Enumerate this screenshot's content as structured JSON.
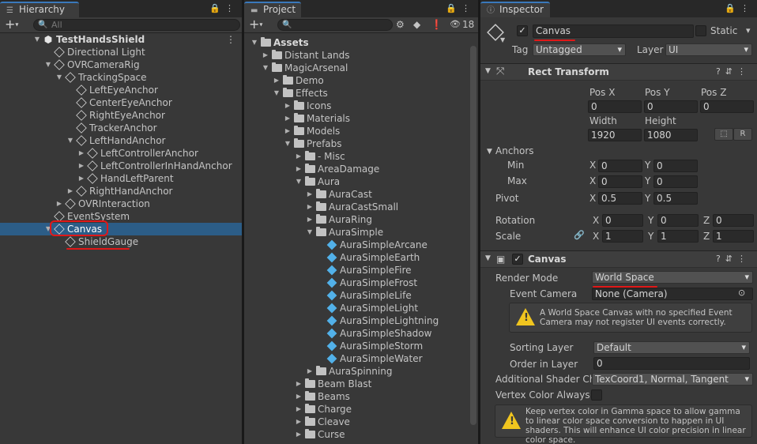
{
  "hierarchy": {
    "tab_label": "Hierarchy",
    "search_placeholder": "All",
    "rows": [
      {
        "label": "TestHandsShield",
        "depth": 0,
        "arrow": "down",
        "icon": "unity-scene-icon",
        "bold": true
      },
      {
        "label": "Directional Light",
        "depth": 1,
        "arrow": "",
        "icon": "cube-icon"
      },
      {
        "label": "OVRCameraRig",
        "depth": 1,
        "arrow": "down",
        "icon": "cube-icon"
      },
      {
        "label": "TrackingSpace",
        "depth": 2,
        "arrow": "down",
        "icon": "cube-icon"
      },
      {
        "label": "LeftEyeAnchor",
        "depth": 3,
        "arrow": "",
        "icon": "cube-icon"
      },
      {
        "label": "CenterEyeAnchor",
        "depth": 3,
        "arrow": "",
        "icon": "cube-icon"
      },
      {
        "label": "RightEyeAnchor",
        "depth": 3,
        "arrow": "",
        "icon": "cube-icon"
      },
      {
        "label": "TrackerAnchor",
        "depth": 3,
        "arrow": "",
        "icon": "cube-icon"
      },
      {
        "label": "LeftHandAnchor",
        "depth": 3,
        "arrow": "down",
        "icon": "cube-icon"
      },
      {
        "label": "LeftControllerAnchor",
        "depth": 4,
        "arrow": "right",
        "icon": "cube-icon"
      },
      {
        "label": "LeftControllerInHandAnchor",
        "depth": 4,
        "arrow": "right",
        "icon": "cube-icon"
      },
      {
        "label": "HandLeftParent",
        "depth": 4,
        "arrow": "right",
        "icon": "cube-icon"
      },
      {
        "label": "RightHandAnchor",
        "depth": 3,
        "arrow": "right",
        "icon": "cube-icon"
      },
      {
        "label": "OVRInteraction",
        "depth": 2,
        "arrow": "right",
        "icon": "cube-icon"
      },
      {
        "label": "EventSystem",
        "depth": 1,
        "arrow": "",
        "icon": "cube-icon"
      },
      {
        "label": "Canvas",
        "depth": 1,
        "arrow": "down",
        "icon": "cube-icon",
        "selected": true
      },
      {
        "label": "ShieldGauge",
        "depth": 2,
        "arrow": "",
        "icon": "cube-icon"
      }
    ]
  },
  "project": {
    "tab_label": "Project",
    "hidden_count": "18",
    "rows": [
      {
        "label": "Assets",
        "depth": 0,
        "arrow": "down",
        "icon": "folder",
        "bold": true
      },
      {
        "label": "Distant Lands",
        "depth": 1,
        "arrow": "right",
        "icon": "folder"
      },
      {
        "label": "MagicArsenal",
        "depth": 1,
        "arrow": "down",
        "icon": "folder"
      },
      {
        "label": "Demo",
        "depth": 2,
        "arrow": "right",
        "icon": "folder"
      },
      {
        "label": "Effects",
        "depth": 2,
        "arrow": "down",
        "icon": "folder"
      },
      {
        "label": "Icons",
        "depth": 3,
        "arrow": "right",
        "icon": "folder"
      },
      {
        "label": "Materials",
        "depth": 3,
        "arrow": "right",
        "icon": "folder"
      },
      {
        "label": "Models",
        "depth": 3,
        "arrow": "right",
        "icon": "folder"
      },
      {
        "label": "Prefabs",
        "depth": 3,
        "arrow": "down",
        "icon": "folder"
      },
      {
        "label": "- Misc",
        "depth": 4,
        "arrow": "right",
        "icon": "folder"
      },
      {
        "label": "AreaDamage",
        "depth": 4,
        "arrow": "right",
        "icon": "folder"
      },
      {
        "label": "Aura",
        "depth": 4,
        "arrow": "down",
        "icon": "folder"
      },
      {
        "label": "AuraCast",
        "depth": 5,
        "arrow": "right",
        "icon": "folder"
      },
      {
        "label": "AuraCastSmall",
        "depth": 5,
        "arrow": "right",
        "icon": "folder"
      },
      {
        "label": "AuraRing",
        "depth": 5,
        "arrow": "right",
        "icon": "folder"
      },
      {
        "label": "AuraSimple",
        "depth": 5,
        "arrow": "down",
        "icon": "folder"
      },
      {
        "label": "AuraSimpleArcane",
        "depth": 6,
        "arrow": "",
        "icon": "prefab"
      },
      {
        "label": "AuraSimpleEarth",
        "depth": 6,
        "arrow": "",
        "icon": "prefab"
      },
      {
        "label": "AuraSimpleFire",
        "depth": 6,
        "arrow": "",
        "icon": "prefab"
      },
      {
        "label": "AuraSimpleFrost",
        "depth": 6,
        "arrow": "",
        "icon": "prefab"
      },
      {
        "label": "AuraSimpleLife",
        "depth": 6,
        "arrow": "",
        "icon": "prefab"
      },
      {
        "label": "AuraSimpleLight",
        "depth": 6,
        "arrow": "",
        "icon": "prefab"
      },
      {
        "label": "AuraSimpleLightning",
        "depth": 6,
        "arrow": "",
        "icon": "prefab"
      },
      {
        "label": "AuraSimpleShadow",
        "depth": 6,
        "arrow": "",
        "icon": "prefab"
      },
      {
        "label": "AuraSimpleStorm",
        "depth": 6,
        "arrow": "",
        "icon": "prefab"
      },
      {
        "label": "AuraSimpleWater",
        "depth": 6,
        "arrow": "",
        "icon": "prefab"
      },
      {
        "label": "AuraSpinning",
        "depth": 5,
        "arrow": "right",
        "icon": "folder"
      },
      {
        "label": "Beam Blast",
        "depth": 4,
        "arrow": "right",
        "icon": "folder"
      },
      {
        "label": "Beams",
        "depth": 4,
        "arrow": "right",
        "icon": "folder"
      },
      {
        "label": "Charge",
        "depth": 4,
        "arrow": "right",
        "icon": "folder"
      },
      {
        "label": "Cleave",
        "depth": 4,
        "arrow": "right",
        "icon": "folder"
      },
      {
        "label": "Curse",
        "depth": 4,
        "arrow": "right",
        "icon": "folder"
      }
    ]
  },
  "inspector": {
    "tab_label": "Inspector",
    "object_name": "Canvas",
    "static_label": "Static",
    "tag_label": "Tag",
    "tag_value": "Untagged",
    "layer_label": "Layer",
    "layer_value": "UI",
    "rect_transform": {
      "title": "Rect Transform",
      "pos_x_label": "Pos X",
      "pos_y_label": "Pos Y",
      "pos_z_label": "Pos Z",
      "pos_x": "0",
      "pos_y": "0",
      "pos_z": "0",
      "width_label": "Width",
      "height_label": "Height",
      "width": "1920",
      "height": "1080",
      "r_button": "R",
      "anchors_label": "Anchors",
      "min_label": "Min",
      "max_label": "Max",
      "min_x": "0",
      "min_y": "0",
      "max_x": "0",
      "max_y": "0",
      "pivot_label": "Pivot",
      "pivot_x": "0.5",
      "pivot_y": "0.5",
      "rotation_label": "Rotation",
      "rot_x": "0",
      "rot_y": "0",
      "rot_z": "0",
      "scale_label": "Scale",
      "scale_x": "1",
      "scale_y": "1",
      "scale_z": "1",
      "x": "X",
      "y": "Y",
      "z": "Z"
    },
    "canvas": {
      "title": "Canvas",
      "render_mode_label": "Render Mode",
      "render_mode": "World Space",
      "event_camera_label": "Event Camera",
      "event_camera": "None (Camera)",
      "warning": "A World Space Canvas with no specified Event Camera may not register UI events correctly.",
      "sorting_layer_label": "Sorting Layer",
      "sorting_layer": "Default",
      "order_in_layer_label": "Order in Layer",
      "order_in_layer": "0",
      "shader_channels_label": "Additional Shader Ch",
      "shader_channels": "TexCoord1, Normal, Tangent",
      "vertex_color_label": "Vertex Color Always I",
      "vertex_info": "Keep vertex color in Gamma space to allow gamma to linear color space conversion to happen in UI shaders. This will enhance UI color precision in linear color space."
    }
  },
  "colors": {
    "selection": "#2c5d87",
    "annotation": "#e01818",
    "prefab": "#52b1e9",
    "warning": "#f0c51f"
  }
}
